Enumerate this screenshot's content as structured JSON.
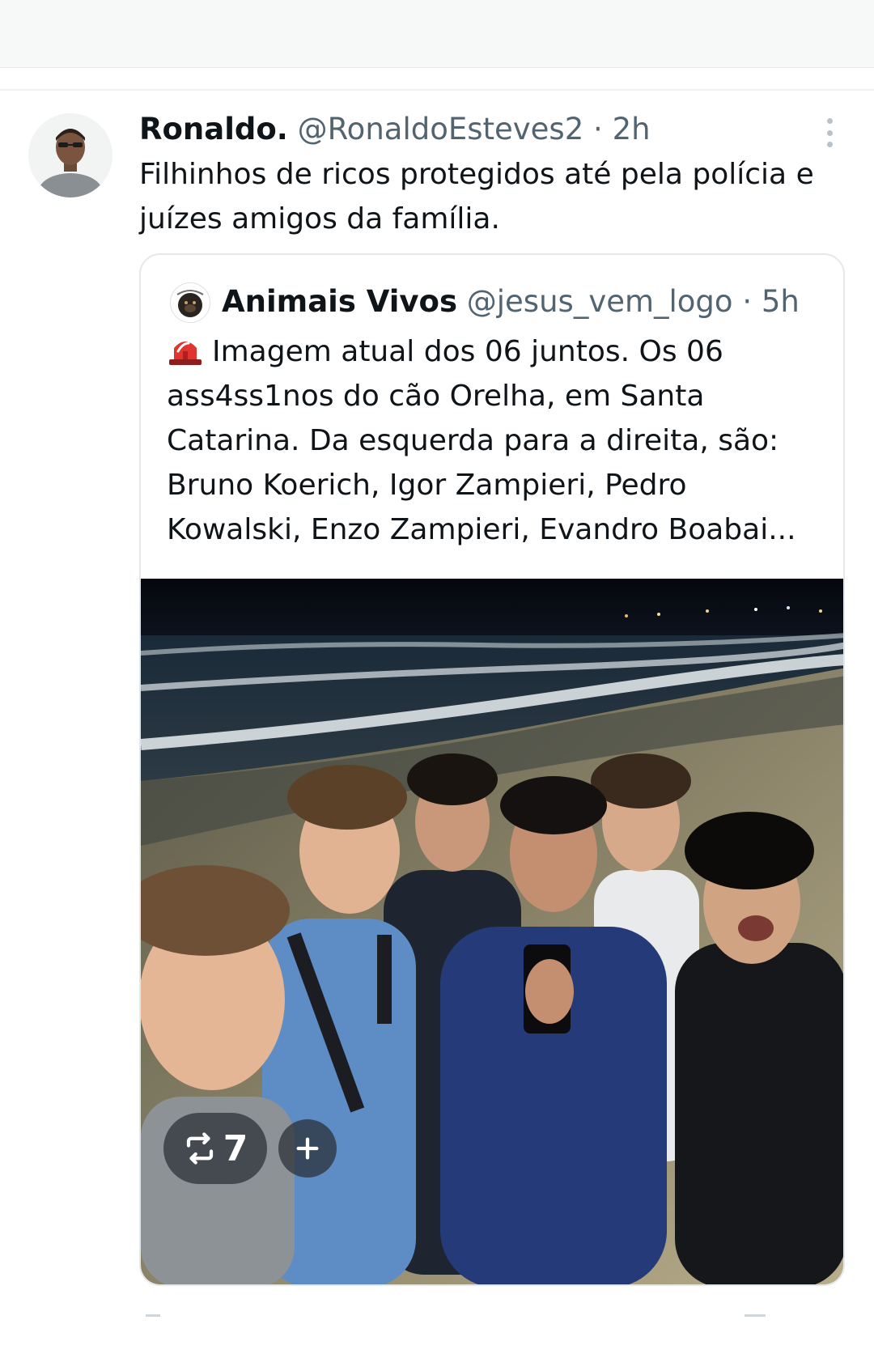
{
  "tweet": {
    "author_name": "Ronaldo.",
    "author_handle": "@RonaldoEsteves2",
    "separator": "·",
    "time": "2h",
    "text": "Filhinhos de ricos protegidos até pela polícia e juízes amigos da família."
  },
  "quoted_tweet": {
    "author_name": "Animais Vivos",
    "author_handle": "@jesus_vem_logo",
    "separator": "·",
    "time": "5h",
    "icon": "siren-icon",
    "text": "Imagem atual dos 06 juntos. Os 06 ass4ss1nos do cão Orelha, em Santa Catarina. Da esquerda para a direita, são: Bruno Koerich, Igor Zampieri, Pedro Kowalski, Enzo Zampieri, Evandro Boabai..."
  },
  "media_overlay": {
    "retweet_count": "7",
    "retweet_icon": "retweet-icon",
    "add_icon": "plus-icon"
  },
  "colors": {
    "text_primary": "#0f1419",
    "text_secondary": "#536471",
    "card_border": "#e3e8eb"
  }
}
